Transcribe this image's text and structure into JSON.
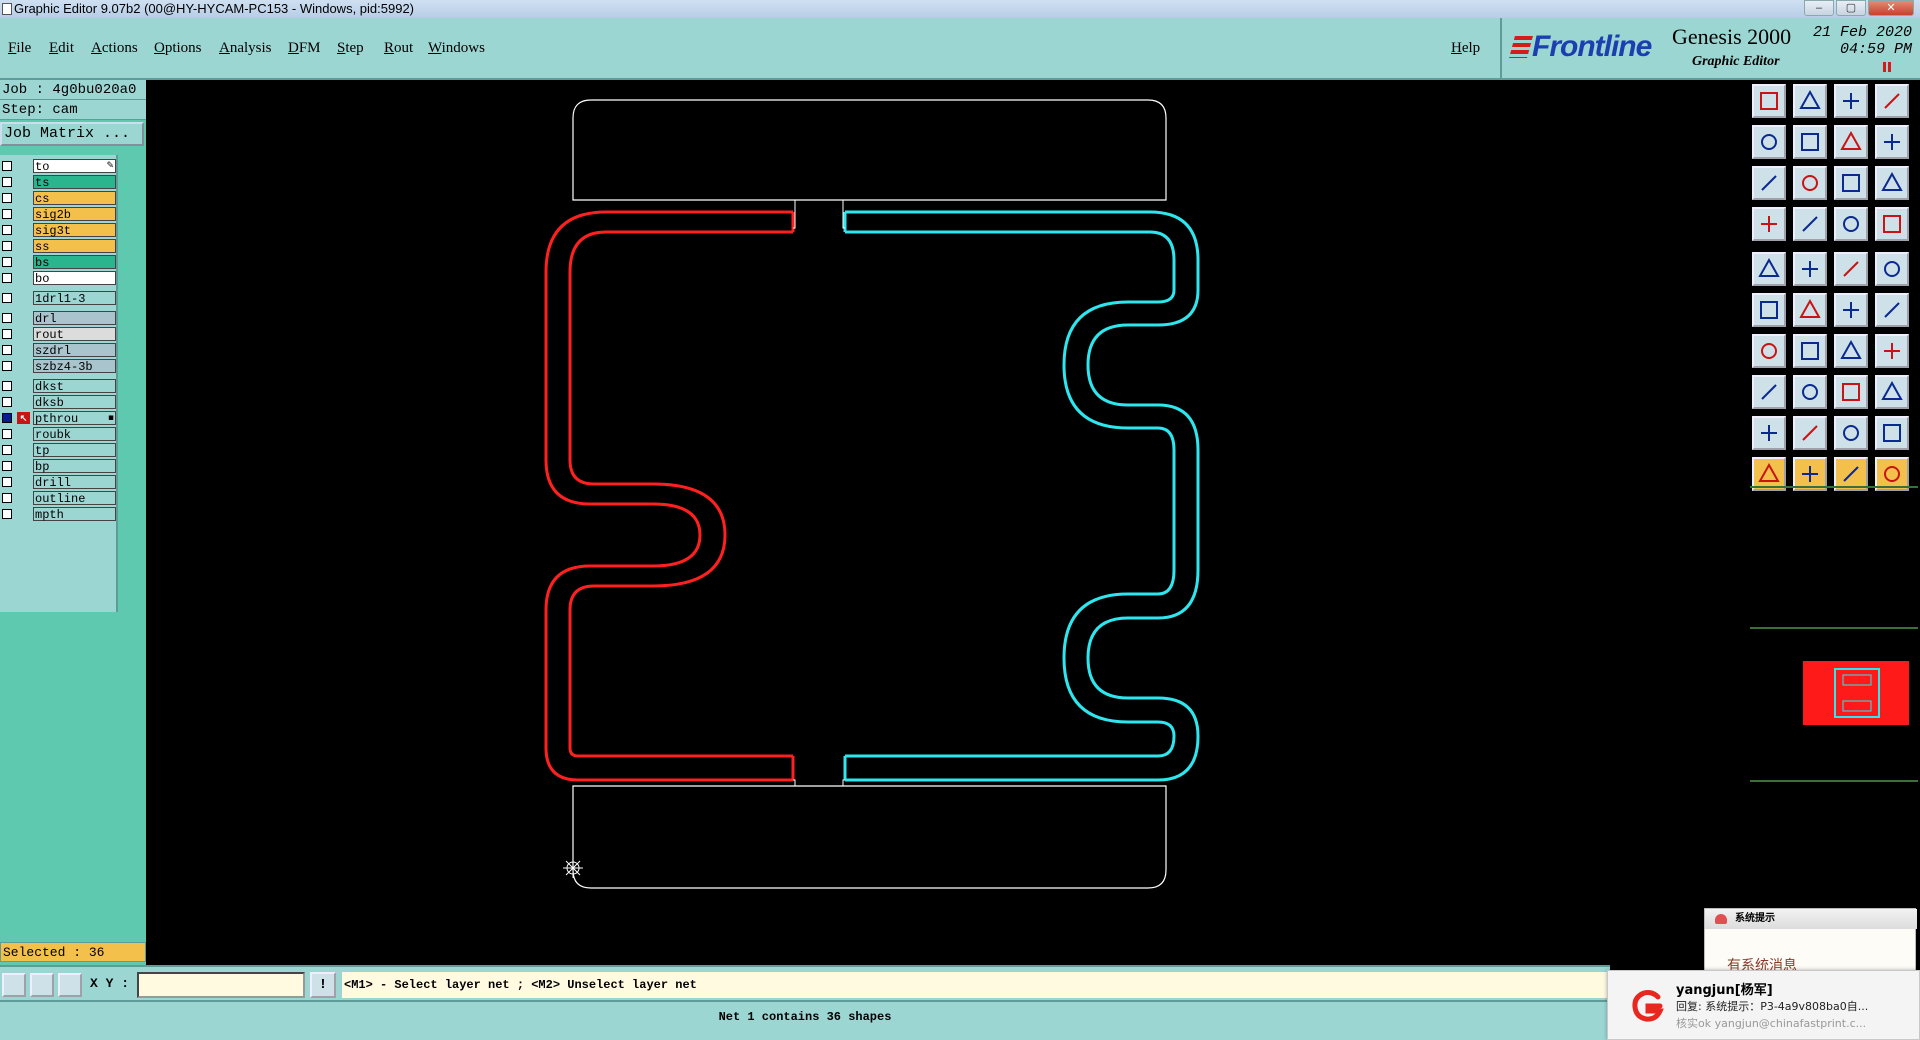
{
  "window": {
    "title": "Graphic Editor 9.07b2 (00@HY-HYCAM-PC153 - Windows, pid:5992)",
    "controls": [
      "–",
      "▢",
      "✕"
    ]
  },
  "menu": [
    "File",
    "Edit",
    "Actions",
    "Options",
    "Analysis",
    "DFM",
    "Step",
    "Rout",
    "Windows"
  ],
  "help_label": "Help",
  "brand": {
    "logo": "Frontline",
    "product": "Genesis 2000",
    "subtitle": "Graphic Editor",
    "date": "21 Feb 2020",
    "time": "04:59 PM",
    "accent": "#d41c1c",
    "logo_color": "#1c3fb0"
  },
  "job": {
    "job_label": "Job : 4g0bu020a0",
    "step_label": "Step: cam",
    "matrix_button": "Job Matrix ..."
  },
  "layers": [
    {
      "name": "to",
      "color": "#ffffff",
      "checked": false,
      "marker": "✎"
    },
    {
      "name": "ts",
      "color": "#2bb58f",
      "checked": false
    },
    {
      "name": "cs",
      "color": "#f4c04c",
      "checked": false
    },
    {
      "name": "sig2b",
      "color": "#f4c04c",
      "checked": false
    },
    {
      "name": "sig3t",
      "color": "#f4c04c",
      "checked": false
    },
    {
      "name": "ss",
      "color": "#f4c04c",
      "checked": false
    },
    {
      "name": "bs",
      "color": "#2bb58f",
      "checked": false
    },
    {
      "name": "bo",
      "color": "#ffffff",
      "checked": false
    },
    {
      "name": "1drl1-3",
      "color": "#9cd6d3",
      "checked": false,
      "gap": true
    },
    {
      "name": "drl",
      "color": "#a9c4cc",
      "checked": false,
      "gap": true
    },
    {
      "name": "rout",
      "color": "#dcdcdc",
      "checked": false
    },
    {
      "name": "szdrl",
      "color": "#a9c4cc",
      "checked": false
    },
    {
      "name": "szbz4-3b",
      "color": "#a9c4cc",
      "checked": false
    },
    {
      "name": "dkst",
      "color": "#9cd6d3",
      "checked": false,
      "gap": true
    },
    {
      "name": "dksb",
      "color": "#9cd6d3",
      "checked": false
    },
    {
      "name": "pthrou",
      "color": "#9cd6d3",
      "checked": true,
      "work": true,
      "marker": "▪"
    },
    {
      "name": "roubk",
      "color": "#9cd6d3",
      "checked": false
    },
    {
      "name": "tp",
      "color": "#9cd6d3",
      "checked": false
    },
    {
      "name": "bp",
      "color": "#9cd6d3",
      "checked": false
    },
    {
      "name": "drill",
      "color": "#9cd6d3",
      "checked": false
    },
    {
      "name": "outline",
      "color": "#9cd6d3",
      "checked": false
    },
    {
      "name": "mpth",
      "color": "#9cd6d3",
      "checked": false
    }
  ],
  "selected_label": "Selected : 36",
  "xy_label": "X Y :",
  "xy_value": "",
  "excl_label": "!",
  "prompt": "<M1> - Select layer net ; <M2> Unselect layer net",
  "net_status": "Net 1 contains 36 shapes",
  "notifications": {
    "system_title": "系统提示",
    "system_body": "有系统消息",
    "msg_name": "yangjun[杨军]",
    "msg_text": "回复: 系统提示：P3-4a9v808ba0自...",
    "msg_meta": "核实ok   yangjun@chinafastprint.c..."
  },
  "colors": {
    "panel": "#9cd6d3",
    "green_panel": "#5fc9af",
    "highlight_red": "#ff2020",
    "highlight_cyan": "#2ee6ee"
  }
}
